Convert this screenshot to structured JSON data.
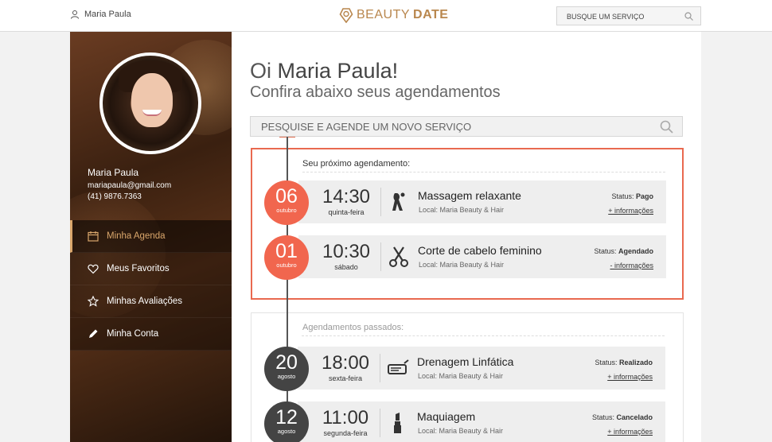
{
  "header": {
    "user_name": "Maria Paula",
    "logo_part1": "BEAUTY",
    "logo_part2": "DATE",
    "search_placeholder": "BUSQUE UM SERVIÇO"
  },
  "sidebar": {
    "profile": {
      "name": "Maria Paula",
      "email": "mariapaula@gmail.com",
      "phone": "(41) 9876.7363"
    },
    "menu": [
      {
        "label": "Minha Agenda",
        "icon": "calendar-icon",
        "active": true
      },
      {
        "label": "Meus Favoritos",
        "icon": "heart-icon",
        "active": false
      },
      {
        "label": "Minhas Avaliações",
        "icon": "star-icon",
        "active": false
      },
      {
        "label": "Minha Conta",
        "icon": "pencil-icon",
        "active": false
      }
    ]
  },
  "main": {
    "greeting_prefix": "Oi ",
    "greeting_name": "Maria Paula!",
    "subtitle": "Confira abaixo seus agendamentos",
    "search_placeholder": "PESQUISE E AGENDE UM NOVO SERVIÇO",
    "next_title": "Seu próximo agendamento:",
    "past_title": "Agendamentos passados:",
    "next": [
      {
        "day": "06",
        "month": "outubro",
        "time": "14:30",
        "weekday": "quinta-feira",
        "service": "Massagem relaxante",
        "location": "Local: Maria Beauty & Hair",
        "status_label": "Status:",
        "status": "Pago",
        "link": "+ informações",
        "icon": "massage-icon"
      },
      {
        "day": "01",
        "month": "outubro",
        "time": "10:30",
        "weekday": "sábado",
        "service": "Corte de cabelo feminino",
        "location": "Local: Maria Beauty & Hair",
        "status_label": "Status:",
        "status": "Agendado",
        "link": "- informações",
        "icon": "scissors-icon"
      }
    ],
    "past": [
      {
        "day": "20",
        "month": "agosto",
        "time": "18:00",
        "weekday": "sexta-feira",
        "service": "Drenagem Linfática",
        "location": "Local: Maria Beauty & Hair",
        "status_label": "Status:",
        "status": "Realizado",
        "link": "+ informações",
        "icon": "drainage-icon"
      },
      {
        "day": "12",
        "month": "agosto",
        "time": "11:00",
        "weekday": "segunda-feira",
        "service": "Maquiagem",
        "location": "Local: Maria Beauty & Hair",
        "status_label": "Status:",
        "status": "Cancelado",
        "link": "+ informações",
        "icon": "lipstick-icon"
      }
    ]
  },
  "colors": {
    "accent": "#d9a66b",
    "orange": "#f1664e",
    "dark_date": "#444444"
  }
}
